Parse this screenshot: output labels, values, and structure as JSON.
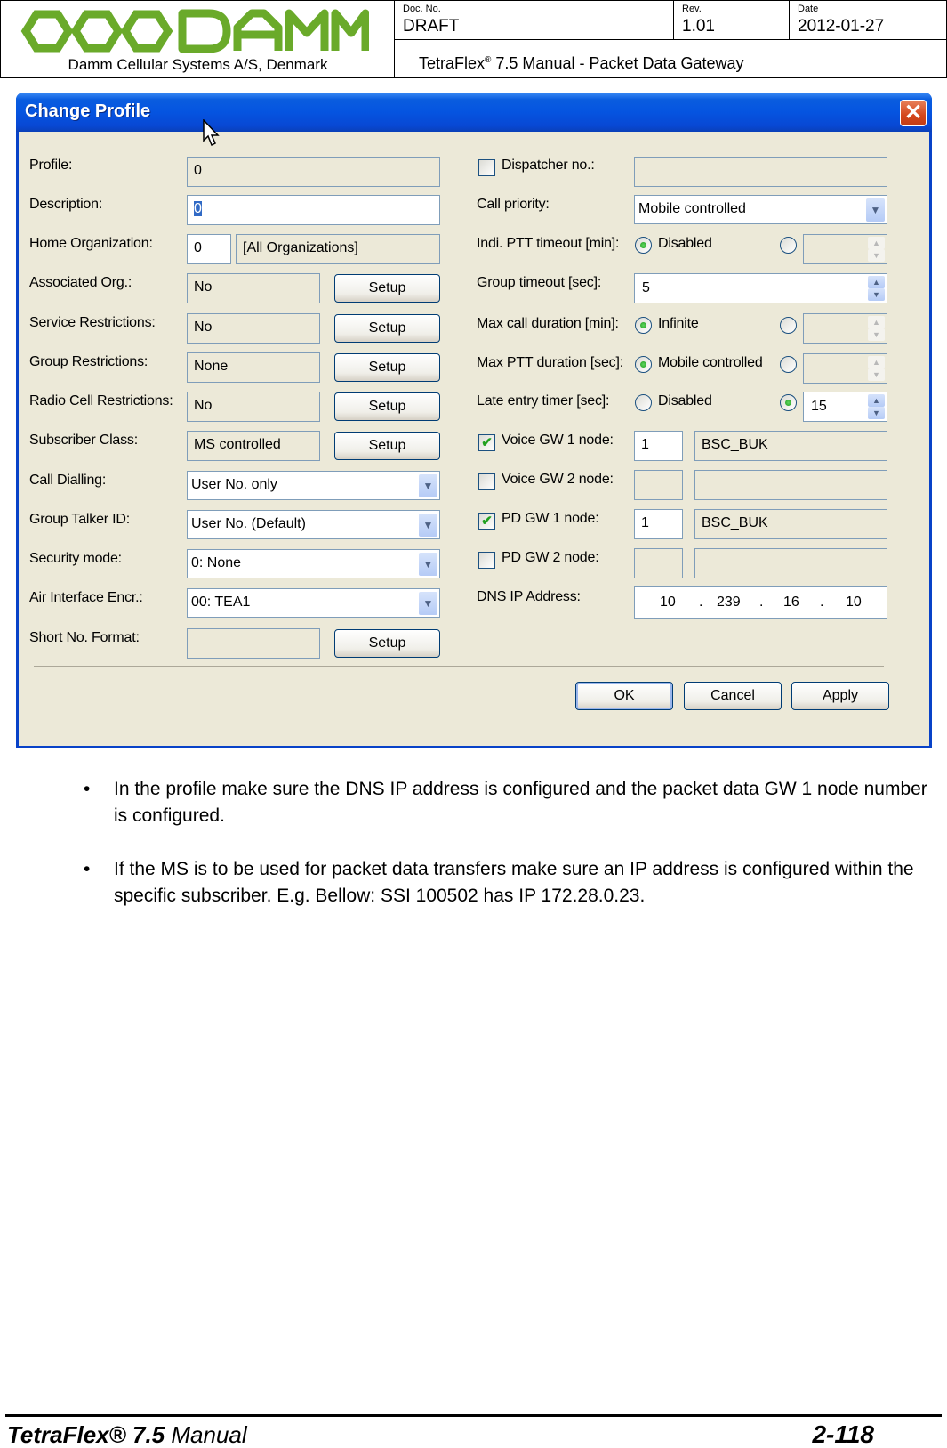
{
  "header": {
    "company": "Damm Cellular Systems A/S, Denmark",
    "logo_text": "DAMM",
    "doc_no_label": "Doc. No.",
    "doc_no_value": "DRAFT",
    "rev_label": "Rev.",
    "rev_value": "1.01",
    "date_label": "Date",
    "date_value": "2012-01-27",
    "title_prefix": "TetraFlex",
    "title_reg": "®",
    "title_suffix": " 7.5 Manual - Packet Data Gateway",
    "brand_color": "#6aaa2a"
  },
  "dialog": {
    "title": "Change Profile",
    "close_icon": "close-icon",
    "left": {
      "profile": {
        "label": "Profile:",
        "value": "0"
      },
      "description": {
        "label": "Description:",
        "value": "0"
      },
      "home_org": {
        "label": "Home Organization:",
        "value": "0",
        "name": "[All Organizations]"
      },
      "associated_org": {
        "label": "Associated Org.:",
        "value": "No",
        "button": "Setup"
      },
      "service_restrictions": {
        "label": "Service Restrictions:",
        "value": "No",
        "button": "Setup"
      },
      "group_restrictions": {
        "label": "Group Restrictions:",
        "value": "None",
        "button": "Setup"
      },
      "radio_cell_restrictions": {
        "label": "Radio Cell Restrictions:",
        "value": "No",
        "button": "Setup"
      },
      "subscriber_class": {
        "label": "Subscriber Class:",
        "value": "MS controlled",
        "button": "Setup"
      },
      "call_dialling": {
        "label": "Call Dialling:",
        "value": "User No. only"
      },
      "group_talker_id": {
        "label": "Group Talker ID:",
        "value": "User No. (Default)"
      },
      "security_mode": {
        "label": "Security mode:",
        "value": "0: None"
      },
      "air_interface_encr": {
        "label": "Air Interface Encr.:",
        "value": "00: TEA1"
      },
      "short_no_format": {
        "label": "Short No. Format:",
        "value": "",
        "button": "Setup"
      }
    },
    "right": {
      "dispatcher_no": {
        "label": "Dispatcher no.:",
        "checked": false,
        "value": ""
      },
      "call_priority": {
        "label": "Call priority:",
        "value": "Mobile controlled"
      },
      "indi_ptt_timeout": {
        "label": "Indi. PTT timeout [min]:",
        "option1": "Disabled",
        "option1_selected": true,
        "value": ""
      },
      "group_timeout": {
        "label": "Group timeout [sec]:",
        "value": "5"
      },
      "max_call_duration": {
        "label": "Max call duration [min]:",
        "option1": "Infinite",
        "option1_selected": true,
        "value": ""
      },
      "max_ptt_duration": {
        "label": "Max PTT duration [sec]:",
        "option1": "Mobile controlled",
        "option1_selected": true,
        "value": ""
      },
      "late_entry_timer": {
        "label": "Late entry timer [sec]:",
        "option1": "Disabled",
        "option1_selected": false,
        "value": "15"
      },
      "voice_gw1": {
        "label": "Voice GW 1 node:",
        "checked": true,
        "node": "1",
        "name": "BSC_BUK"
      },
      "voice_gw2": {
        "label": "Voice GW 2 node:",
        "checked": false,
        "node": "",
        "name": ""
      },
      "pd_gw1": {
        "label": "PD GW 1 node:",
        "checked": true,
        "node": "1",
        "name": "BSC_BUK"
      },
      "pd_gw2": {
        "label": "PD GW 2 node:",
        "checked": false,
        "node": "",
        "name": ""
      },
      "dns_ip": {
        "label": "DNS IP Address:",
        "octets": [
          "10",
          "239",
          "16",
          "10"
        ],
        "dot": "."
      }
    },
    "buttons": {
      "ok": "OK",
      "cancel": "Cancel",
      "apply": "Apply"
    },
    "check_glyph": "✔",
    "arrow_down": "▼",
    "arrow_up": "▲",
    "close_glyph": "✕"
  },
  "body": {
    "bullets": [
      "In the profile make sure the DNS IP address is configured and the packet data GW 1 node number is configured.",
      "If the MS is to be used for packet data transfers make sure an IP address is configured within the specific subscriber. E.g. Bellow: SSI 100502 has IP 172.28.0.23."
    ]
  },
  "footer": {
    "left_bold": "TetraFlex® 7.5",
    "left_normal": " Manual",
    "page": "2-118"
  }
}
